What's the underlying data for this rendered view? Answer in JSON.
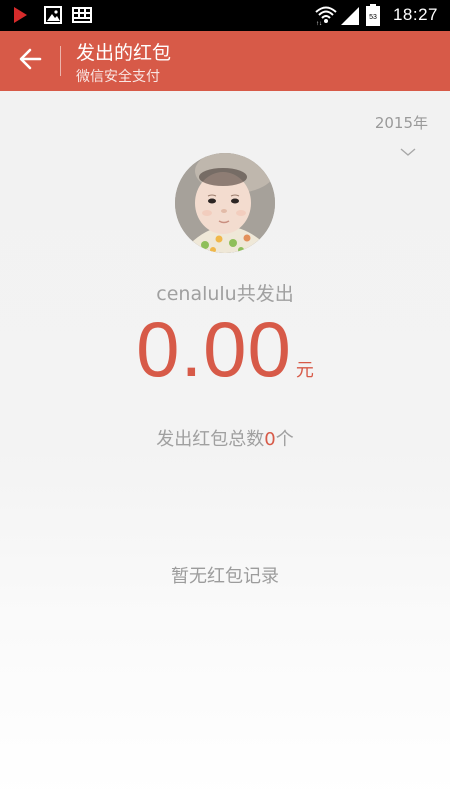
{
  "status_bar": {
    "time": "18:27",
    "battery_level": "53",
    "left_icons": [
      "play-store-icon",
      "gallery-icon",
      "keyboard-icon"
    ],
    "right_icons": [
      "wifi-icon",
      "signal-icon",
      "battery-icon"
    ]
  },
  "app_bar": {
    "title": "发出的红包",
    "subtitle": "微信安全支付",
    "back_icon": "back-arrow-icon",
    "background_color": "#d75a48"
  },
  "year_selector": {
    "year": "2015年",
    "icon": "chevron-down-icon"
  },
  "summary": {
    "sent_label": "cenalulu共发出",
    "amount": "0.00",
    "currency_unit": "元",
    "count_prefix": "发出红包总数",
    "count": "0",
    "count_suffix": "个",
    "accent_color": "#d75a48"
  },
  "empty_state": {
    "text": "暂无红包记录"
  }
}
